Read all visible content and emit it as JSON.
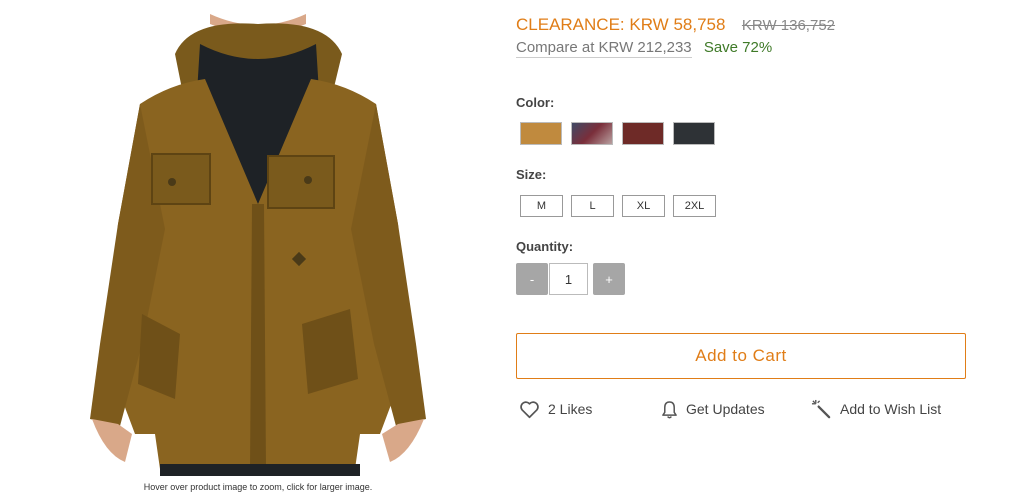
{
  "product": {
    "image_caption": "Hover over product image to zoom, click for larger image."
  },
  "pricing": {
    "clearance": "CLEARANCE: KRW 58,758",
    "original": "KRW 136,752",
    "compare": "Compare at KRW 212,233",
    "save": "Save 72%"
  },
  "color": {
    "label": "Color:",
    "swatches": [
      {
        "name": "tan",
        "hex": "#c08a3e"
      },
      {
        "name": "plaid",
        "hex": "#6a5560"
      },
      {
        "name": "maroon",
        "hex": "#6e2a27"
      },
      {
        "name": "charcoal",
        "hex": "#2e3236"
      }
    ]
  },
  "size": {
    "label": "Size:",
    "options": [
      "M",
      "L",
      "XL",
      "2XL"
    ]
  },
  "quantity": {
    "label": "Quantity:",
    "minus": "-",
    "value": "1",
    "plus": "+"
  },
  "cart": {
    "add_label": "Add to Cart"
  },
  "actions": {
    "likes": "2 Likes",
    "updates": "Get Updates",
    "wishlist": "Add to Wish List"
  },
  "colors": {
    "accent": "#e07d17",
    "save_green": "#3f7a28",
    "qty_button_gray": "#a6a6a6"
  }
}
